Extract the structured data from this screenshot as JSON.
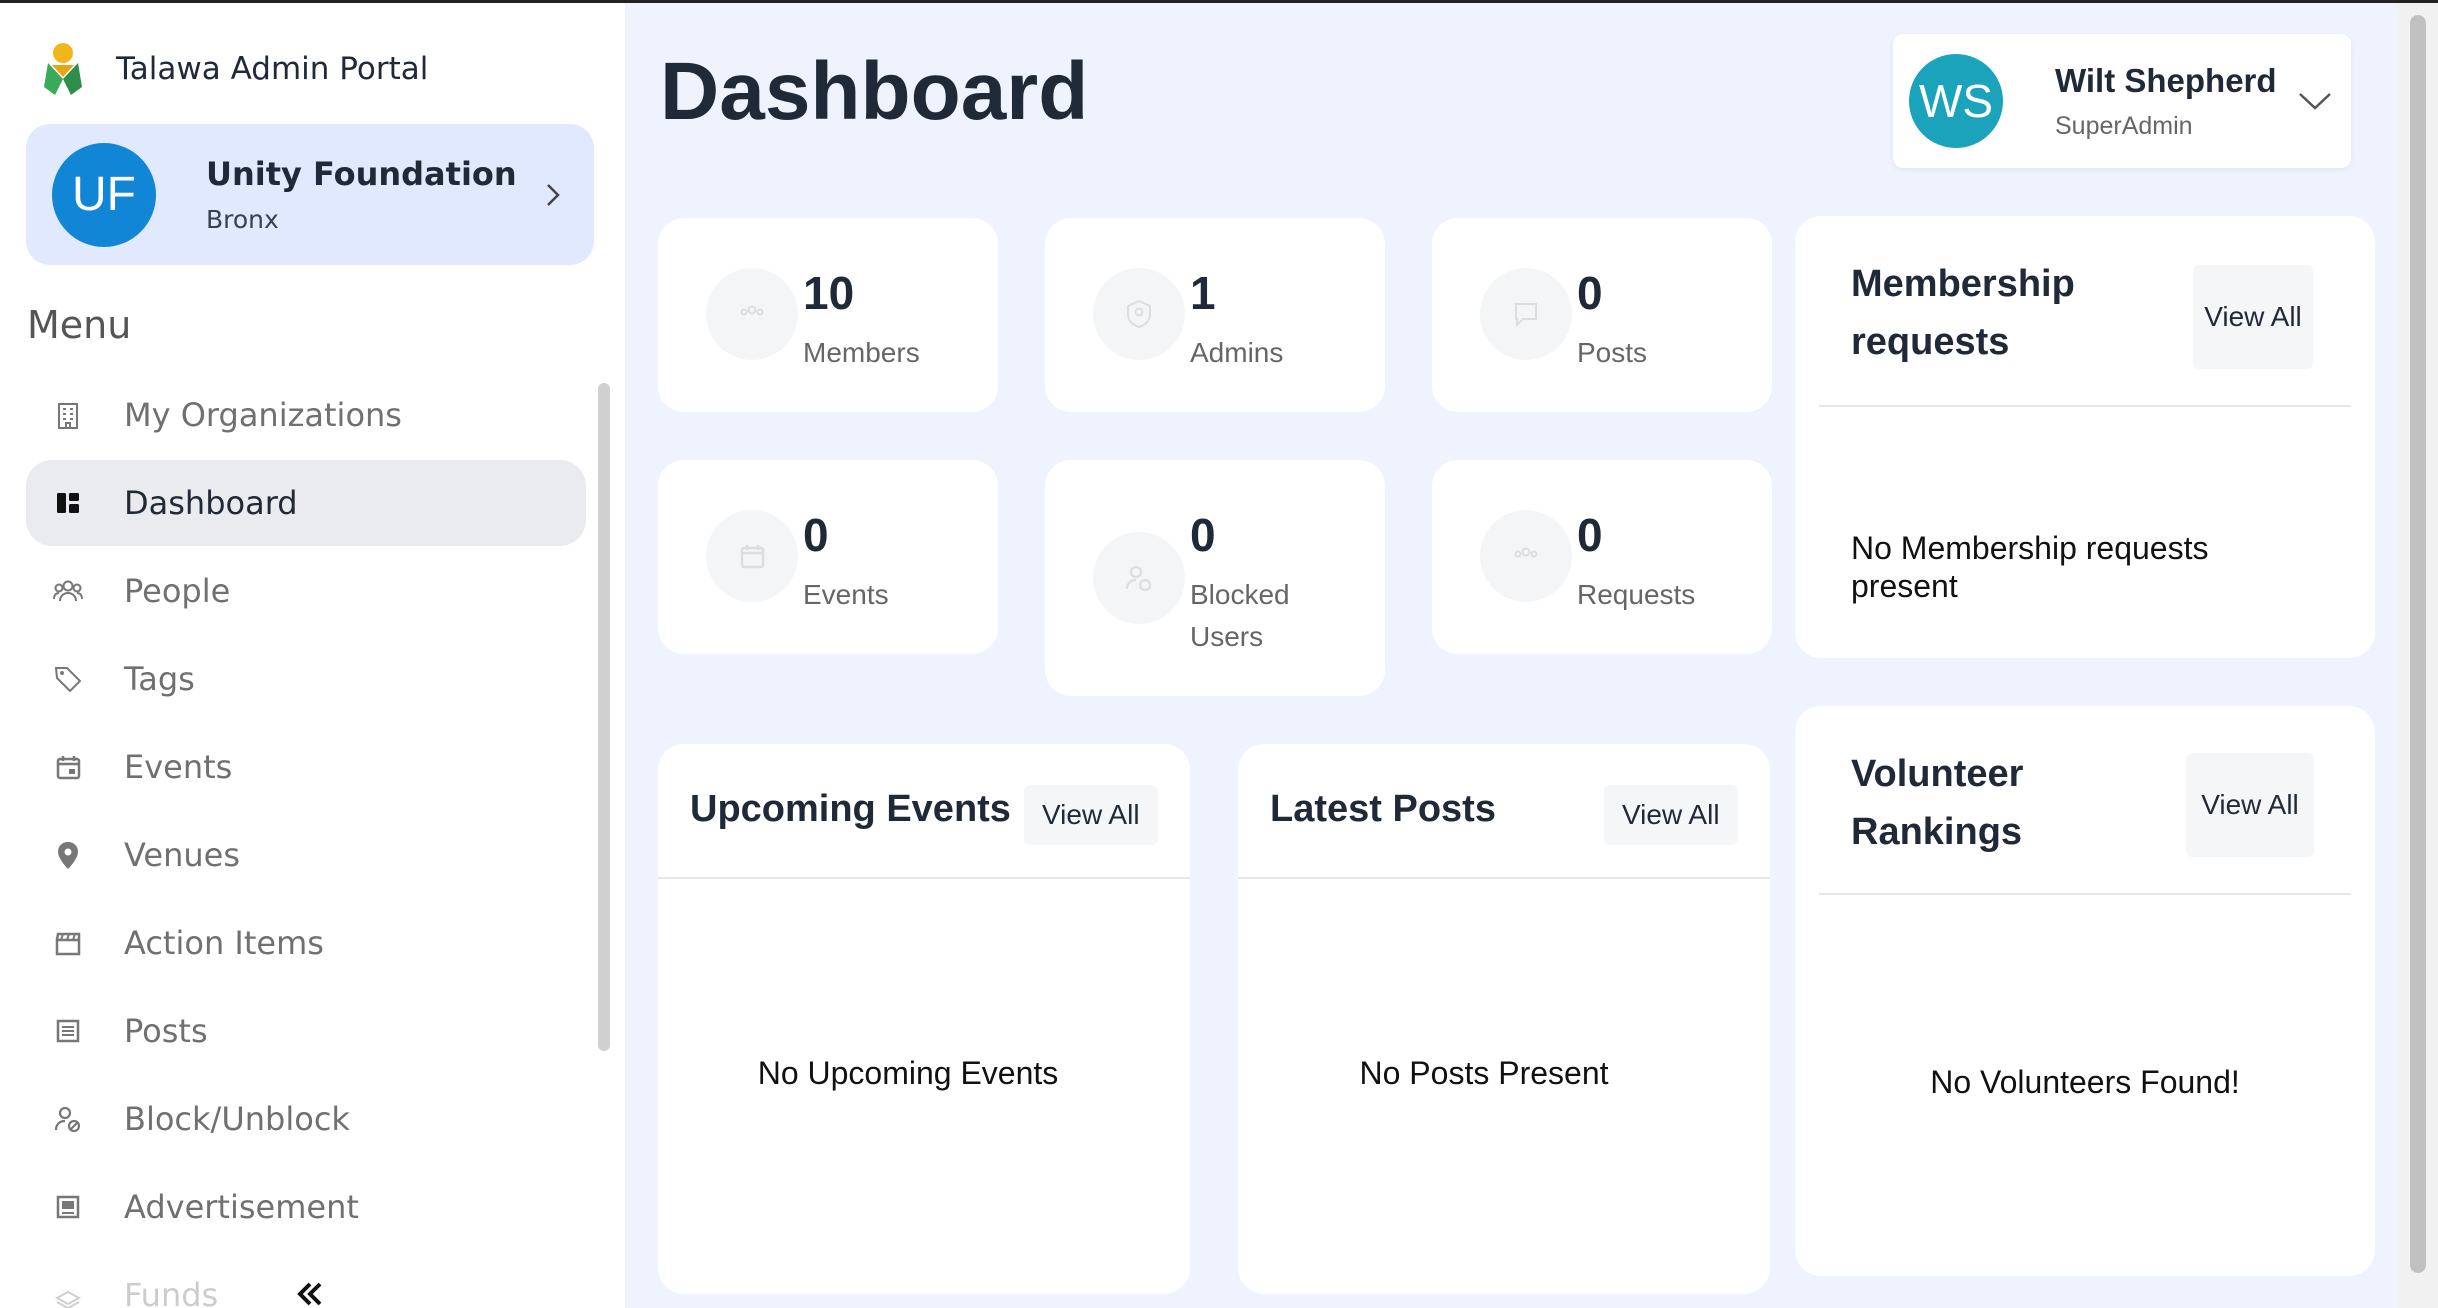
{
  "app": {
    "title": "Talawa Admin Portal"
  },
  "org": {
    "initials": "UF",
    "name": "Unity Foundation",
    "location": "Bronx"
  },
  "menu": {
    "title": "Menu",
    "items": [
      {
        "label": "My Organizations",
        "icon": "building-icon",
        "active": false
      },
      {
        "label": "Dashboard",
        "icon": "dashboard-icon",
        "active": true
      },
      {
        "label": "People",
        "icon": "people-icon",
        "active": false
      },
      {
        "label": "Tags",
        "icon": "tag-icon",
        "active": false
      },
      {
        "label": "Events",
        "icon": "calendar-icon",
        "active": false
      },
      {
        "label": "Venues",
        "icon": "location-pin-icon",
        "active": false
      },
      {
        "label": "Action Items",
        "icon": "clapperboard-icon",
        "active": false
      },
      {
        "label": "Posts",
        "icon": "post-icon",
        "active": false
      },
      {
        "label": "Block/Unblock",
        "icon": "user-block-icon",
        "active": false
      },
      {
        "label": "Advertisement",
        "icon": "advertisement-icon",
        "active": false
      },
      {
        "label": "Funds",
        "icon": "funds-icon",
        "active": false
      }
    ]
  },
  "page": {
    "title": "Dashboard"
  },
  "user": {
    "initials": "WS",
    "name": "Wilt Shepherd",
    "role": "SuperAdmin"
  },
  "stats": [
    {
      "value": "10",
      "label": "Members",
      "icon": "members-icon"
    },
    {
      "value": "1",
      "label": "Admins",
      "icon": "admin-shield-icon"
    },
    {
      "value": "0",
      "label": "Posts",
      "icon": "chat-bubble-icon"
    },
    {
      "value": "0",
      "label": "Events",
      "icon": "calendar-icon"
    },
    {
      "value": "0",
      "label": "Blocked Users",
      "icon": "user-block-icon"
    },
    {
      "value": "0",
      "label": "Requests",
      "icon": "requests-icon"
    }
  ],
  "membership": {
    "title": "Membership requests",
    "view_all": "View All",
    "empty": "No Membership requests present"
  },
  "volunteers": {
    "title": "Volunteer Rankings",
    "view_all": "View All",
    "empty": "No Volunteers Found!"
  },
  "upcoming_events": {
    "title": "Upcoming Events",
    "view_all": "View All",
    "empty": "No Upcoming Events"
  },
  "latest_posts": {
    "title": "Latest Posts",
    "view_all": "View All",
    "empty": "No Posts Present"
  },
  "colors": {
    "org_avatar": "#1185d6",
    "user_avatar": "#1aa3bb",
    "main_bg": "#eef3fd",
    "org_card_bg": "#e0e9fd"
  }
}
